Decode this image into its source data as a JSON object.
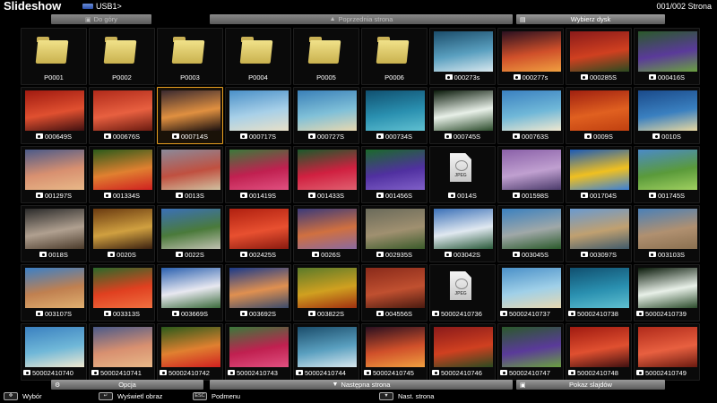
{
  "header": {
    "title": "Slideshow",
    "source": "USB1>",
    "page": "001/002 Strona"
  },
  "nav": {
    "up": "Do góry",
    "prev": "Poprzednia strona",
    "select_disk": "Wybierz dysk"
  },
  "items": [
    {
      "label": "P0001",
      "kind": "folder"
    },
    {
      "label": "P0002",
      "kind": "folder"
    },
    {
      "label": "P0003",
      "kind": "folder"
    },
    {
      "label": "P0004",
      "kind": "folder"
    },
    {
      "label": "P0005",
      "kind": "folder"
    },
    {
      "label": "P0006",
      "kind": "folder"
    },
    {
      "label": "000273s",
      "kind": "photo",
      "colors": [
        "#1b4d6b",
        "#5aa0c0",
        "#d8e8ee"
      ]
    },
    {
      "label": "000277s",
      "kind": "photo",
      "colors": [
        "#2a1020",
        "#d0502a",
        "#f0a040"
      ]
    },
    {
      "label": "000285S",
      "kind": "photo",
      "colors": [
        "#8a1a1a",
        "#d04020",
        "#2a4a20"
      ]
    },
    {
      "label": "000416S",
      "kind": "photo",
      "colors": [
        "#2a5a2a",
        "#5a3a9a",
        "#6aa040"
      ]
    },
    {
      "label": "000649S",
      "kind": "photo",
      "colors": [
        "#a01a10",
        "#e05030",
        "#401010"
      ]
    },
    {
      "label": "000676S",
      "kind": "photo",
      "colors": [
        "#b02a1a",
        "#e86040",
        "#6a1a10"
      ]
    },
    {
      "label": "000714S",
      "kind": "photo",
      "colors": [
        "#3a2a30",
        "#e09040",
        "#1a1010"
      ],
      "selected": true
    },
    {
      "label": "000717S",
      "kind": "photo",
      "colors": [
        "#4a90c8",
        "#a8d0e8",
        "#e8e0c8"
      ]
    },
    {
      "label": "000727S",
      "kind": "photo",
      "colors": [
        "#3a80b8",
        "#80c0d8",
        "#e8d8b0"
      ]
    },
    {
      "label": "000734S",
      "kind": "photo",
      "colors": [
        "#105070",
        "#2a90b0",
        "#60c0d0"
      ]
    },
    {
      "label": "000745S",
      "kind": "photo",
      "colors": [
        "#0a1a0a",
        "#e8f0e8",
        "#2a4a2a"
      ]
    },
    {
      "label": "000763S",
      "kind": "photo",
      "colors": [
        "#3a80c0",
        "#70b8d8",
        "#f0e8d0"
      ]
    },
    {
      "label": "0009S",
      "kind": "photo",
      "colors": [
        "#a02010",
        "#e06020",
        "#c04010"
      ]
    },
    {
      "label": "0010S",
      "kind": "photo",
      "colors": [
        "#1a4a8a",
        "#3a80c0",
        "#e8d8a0"
      ]
    },
    {
      "label": "001297S",
      "kind": "photo",
      "colors": [
        "#4a5a8a",
        "#d89070",
        "#e8b888"
      ]
    },
    {
      "label": "001334S",
      "kind": "photo",
      "colors": [
        "#2a5a1a",
        "#e08030",
        "#d02020"
      ]
    },
    {
      "label": "0013S",
      "kind": "photo",
      "colors": [
        "#8a8a9a",
        "#c05040",
        "#d0c0a0"
      ]
    },
    {
      "label": "001419S",
      "kind": "photo",
      "colors": [
        "#3a7a3a",
        "#c02050",
        "#e05080"
      ]
    },
    {
      "label": "001433S",
      "kind": "photo",
      "colors": [
        "#1a5a2a",
        "#d02040",
        "#e06070"
      ]
    },
    {
      "label": "001456S",
      "kind": "photo",
      "colors": [
        "#1a6a2a",
        "#5030a0",
        "#8060c8"
      ]
    },
    {
      "label": "0014S",
      "kind": "jpeg"
    },
    {
      "label": "001598S",
      "kind": "photo",
      "colors": [
        "#8a60a8",
        "#c0a0d0",
        "#4a3a6a"
      ]
    },
    {
      "label": "001704S",
      "kind": "photo",
      "colors": [
        "#1a5ab8",
        "#f0c020",
        "#3a80d8"
      ]
    },
    {
      "label": "001745S",
      "kind": "photo",
      "colors": [
        "#4a8ac8",
        "#5a9a3a",
        "#a0d060"
      ]
    },
    {
      "label": "0018S",
      "kind": "photo",
      "colors": [
        "#2a2a2a",
        "#b0a090",
        "#4a3a2a"
      ]
    },
    {
      "label": "0020S",
      "kind": "photo",
      "colors": [
        "#6a3a10",
        "#d0a040",
        "#3a2010"
      ]
    },
    {
      "label": "0022S",
      "kind": "photo",
      "colors": [
        "#3a70b8",
        "#4a7a3a",
        "#c0c0b0"
      ]
    },
    {
      "label": "002425S",
      "kind": "photo",
      "colors": [
        "#b02010",
        "#e85030",
        "#8a1a10"
      ]
    },
    {
      "label": "0026S",
      "kind": "photo",
      "colors": [
        "#3a3a7a",
        "#d07040",
        "#8a6aa0"
      ]
    },
    {
      "label": "002935S",
      "kind": "photo",
      "colors": [
        "#6a6a5a",
        "#a09070",
        "#3a5a2a"
      ]
    },
    {
      "label": "003042S",
      "kind": "photo",
      "colors": [
        "#3a70b8",
        "#e0e8f0",
        "#2a5a3a"
      ]
    },
    {
      "label": "003045S",
      "kind": "photo",
      "colors": [
        "#3a80c0",
        "#a0a8a8",
        "#2a5a2a"
      ]
    },
    {
      "label": "003097S",
      "kind": "photo",
      "colors": [
        "#6a9ad0",
        "#c0a070",
        "#405a6a"
      ]
    },
    {
      "label": "003103S",
      "kind": "photo",
      "colors": [
        "#4a80b8",
        "#b09070",
        "#8a7050"
      ]
    },
    {
      "label": "003107S",
      "kind": "photo",
      "colors": [
        "#3a80c8",
        "#c08050",
        "#e0b070"
      ]
    },
    {
      "label": "003313S",
      "kind": "photo",
      "colors": [
        "#2a6a2a",
        "#e04020",
        "#f07040"
      ]
    },
    {
      "label": "003669S",
      "kind": "photo",
      "colors": [
        "#2a60b0",
        "#e8e8f0",
        "#3a6a3a"
      ]
    },
    {
      "label": "003692S",
      "kind": "photo",
      "colors": [
        "#1a3a8a",
        "#e09050",
        "#3a4a6a"
      ]
    },
    {
      "label": "003822S",
      "kind": "photo",
      "colors": [
        "#5a7a2a",
        "#d0a020",
        "#a03010"
      ]
    },
    {
      "label": "004556S",
      "kind": "photo",
      "colors": [
        "#8a2a1a",
        "#c05030",
        "#4a1a10"
      ]
    },
    {
      "label": "50002410736",
      "kind": "jpeg"
    },
    {
      "label": "50002410737",
      "kind": "photo",
      "colors": [
        "#4a90c8",
        "#a0d0e8",
        "#e8d8b0"
      ]
    },
    {
      "label": "50002410738",
      "kind": "photo",
      "colors": [
        "#105070",
        "#2a90b0",
        "#60c0d0"
      ]
    },
    {
      "label": "50002410739",
      "kind": "photo",
      "colors": [
        "#0a1a0a",
        "#e8f0e8",
        "#2a4a2a"
      ]
    },
    {
      "label": "50002410740",
      "kind": "photo",
      "colors": [
        "#3a80c0",
        "#70b8d8",
        "#f0e8d0"
      ]
    },
    {
      "label": "50002410741",
      "kind": "photo",
      "colors": [
        "#4a5a8a",
        "#d89070",
        "#e8b888"
      ]
    },
    {
      "label": "50002410742",
      "kind": "photo",
      "colors": [
        "#2a5a1a",
        "#e08030",
        "#d02020"
      ]
    },
    {
      "label": "50002410743",
      "kind": "photo",
      "colors": [
        "#3a7a3a",
        "#c02050",
        "#e05080"
      ]
    },
    {
      "label": "50002410744",
      "kind": "photo",
      "colors": [
        "#1b4d6b",
        "#5aa0c0",
        "#d8e8ee"
      ]
    },
    {
      "label": "50002410745",
      "kind": "photo",
      "colors": [
        "#2a1020",
        "#d0502a",
        "#f0a040"
      ]
    },
    {
      "label": "50002410746",
      "kind": "photo",
      "colors": [
        "#8a1a1a",
        "#d04020",
        "#2a4a20"
      ]
    },
    {
      "label": "50002410747",
      "kind": "photo",
      "colors": [
        "#2a5a2a",
        "#5a3a9a",
        "#6aa040"
      ]
    },
    {
      "label": "50002410748",
      "kind": "photo",
      "colors": [
        "#a01a10",
        "#e05030",
        "#401010"
      ]
    },
    {
      "label": "50002410749",
      "kind": "photo",
      "colors": [
        "#b02a1a",
        "#e86040",
        "#6a1a10"
      ]
    }
  ],
  "bottom": {
    "option": "Opcja",
    "next": "Następna strona",
    "slideshow": "Pokaz slajdów"
  },
  "hints": [
    {
      "key": "✥",
      "label": "Wybór"
    },
    {
      "key": "↵",
      "label": "Wyświetl obraz"
    },
    {
      "key": "ESC",
      "label": "Podmenu"
    },
    {
      "key": "▼",
      "label": "Nast. strona"
    }
  ],
  "jpeg_text": "JPEG"
}
